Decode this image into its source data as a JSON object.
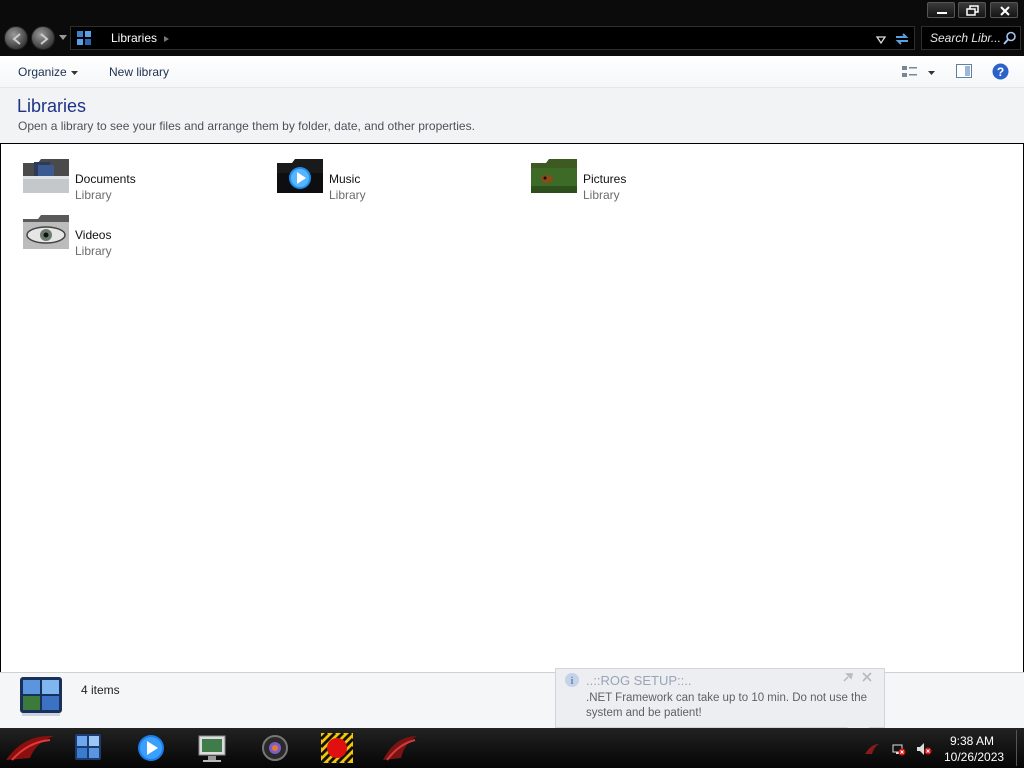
{
  "window": {
    "address": "Libraries",
    "search_placeholder": "Search Libr..."
  },
  "toolbar": {
    "organize_label": "Organize",
    "new_library_label": "New library"
  },
  "header": {
    "title": "Libraries",
    "description": "Open a library to see your files and arrange them by folder, date, and other properties."
  },
  "libraries": [
    {
      "name": "Documents",
      "type": "Library",
      "icon": "documents-library-icon"
    },
    {
      "name": "Music",
      "type": "Library",
      "icon": "music-library-icon"
    },
    {
      "name": "Pictures",
      "type": "Library",
      "icon": "pictures-library-icon"
    },
    {
      "name": "Videos",
      "type": "Library",
      "icon": "videos-library-icon"
    }
  ],
  "details": {
    "item_count": "4 items"
  },
  "balloon": {
    "title": "..::ROG SETUP::..",
    "message": ".NET Framework can take up to 10 min. Do not use the system and be patient!"
  },
  "taskbar": {
    "pinned": [
      "rog-start-icon",
      "explorer-icon",
      "media-player-icon",
      "remote-desktop-icon",
      "camera-app-icon",
      "record-app-icon",
      "rog-app-icon"
    ]
  },
  "clock": {
    "time": "9:38 AM",
    "date": "10/26/2023"
  },
  "colors": {
    "chrome": "#0b0b0b",
    "title_blue": "#1e3287",
    "taskbar": "#111111"
  }
}
